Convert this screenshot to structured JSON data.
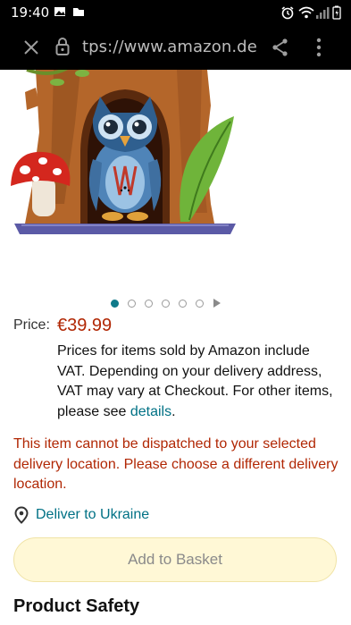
{
  "status_bar": {
    "time": "19:40"
  },
  "browser": {
    "url": "tps://www.amazon.de/S"
  },
  "carousel": {
    "dot_count": 6,
    "active_index": 0
  },
  "price": {
    "label": "Price:",
    "value": "€39.99"
  },
  "vat_note": {
    "text": "Prices for items sold by Amazon include VAT. Depending on your delivery address, VAT may vary at Checkout. For other items, please see ",
    "link": "details",
    "suffix": "."
  },
  "warning": "This item cannot be dispatched to your selected delivery location. Please choose a different delivery location.",
  "deliver_to": "Deliver to Ukraine",
  "add_to_basket": "Add to Basket",
  "section_title": "Product Safety",
  "colors": {
    "price": "#b12704",
    "link": "#007185",
    "button_bg": "#fff8d6"
  }
}
